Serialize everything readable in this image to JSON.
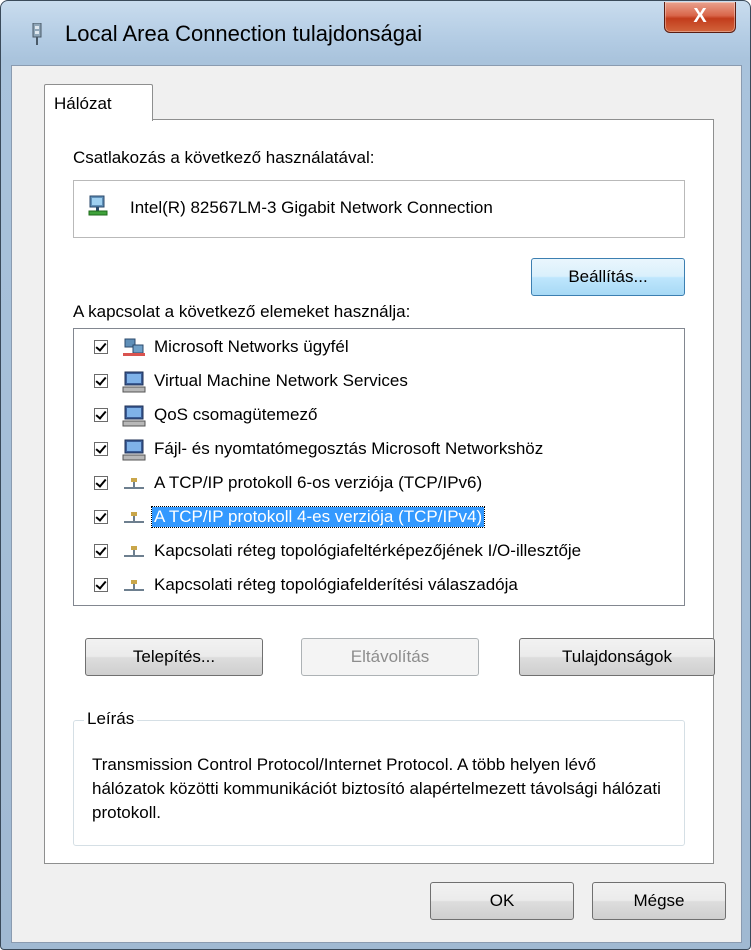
{
  "window": {
    "title": "Local Area Connection tulajdonságai",
    "close_label": "X"
  },
  "tabs": [
    {
      "label": "Hálózat"
    }
  ],
  "connect_using": {
    "label": "Csatlakozás a következő használatával:",
    "adapter_name": "Intel(R) 82567LM-3 Gigabit Network Connection",
    "configure_button": "Beállítás..."
  },
  "items_section": {
    "label": "A kapcsolat a következő elemeket használja:"
  },
  "items": [
    {
      "label": "Microsoft Networks ügyfél",
      "checked": true,
      "icon": "network-client-icon"
    },
    {
      "label": "Virtual Machine Network Services",
      "checked": true,
      "icon": "network-service-icon"
    },
    {
      "label": "QoS csomagütemező",
      "checked": true,
      "icon": "network-service-icon"
    },
    {
      "label": "Fájl- és nyomtatómegosztás Microsoft Networkshöz",
      "checked": true,
      "icon": "network-service-icon"
    },
    {
      "label": "A TCP/IP protokoll 6-os verziója (TCP/IPv6)",
      "checked": true,
      "icon": "protocol-icon"
    },
    {
      "label": "A TCP/IP protokoll 4-es verziója (TCP/IPv4)",
      "checked": true,
      "icon": "protocol-icon",
      "selected": true
    },
    {
      "label": "Kapcsolati réteg topológiafeltérképezőjének I/O-illesztője",
      "checked": true,
      "icon": "protocol-icon"
    },
    {
      "label": "Kapcsolati réteg topológiafelderítési válaszadója",
      "checked": true,
      "icon": "protocol-icon"
    }
  ],
  "buttons": {
    "install": "Telepítés...",
    "uninstall": "Eltávolítás",
    "properties": "Tulajdonságok",
    "ok": "OK",
    "cancel": "Mégse"
  },
  "description": {
    "title": "Leírás",
    "text": "Transmission Control Protocol/Internet Protocol. A több helyen lévő hálózatok közötti kommunikációt biztosító alapértelmezett távolsági hálózati protokoll."
  },
  "colors": {
    "selection": "#3399ff",
    "close_button": "#c23c1c",
    "focused_button": "#bee6fd"
  }
}
